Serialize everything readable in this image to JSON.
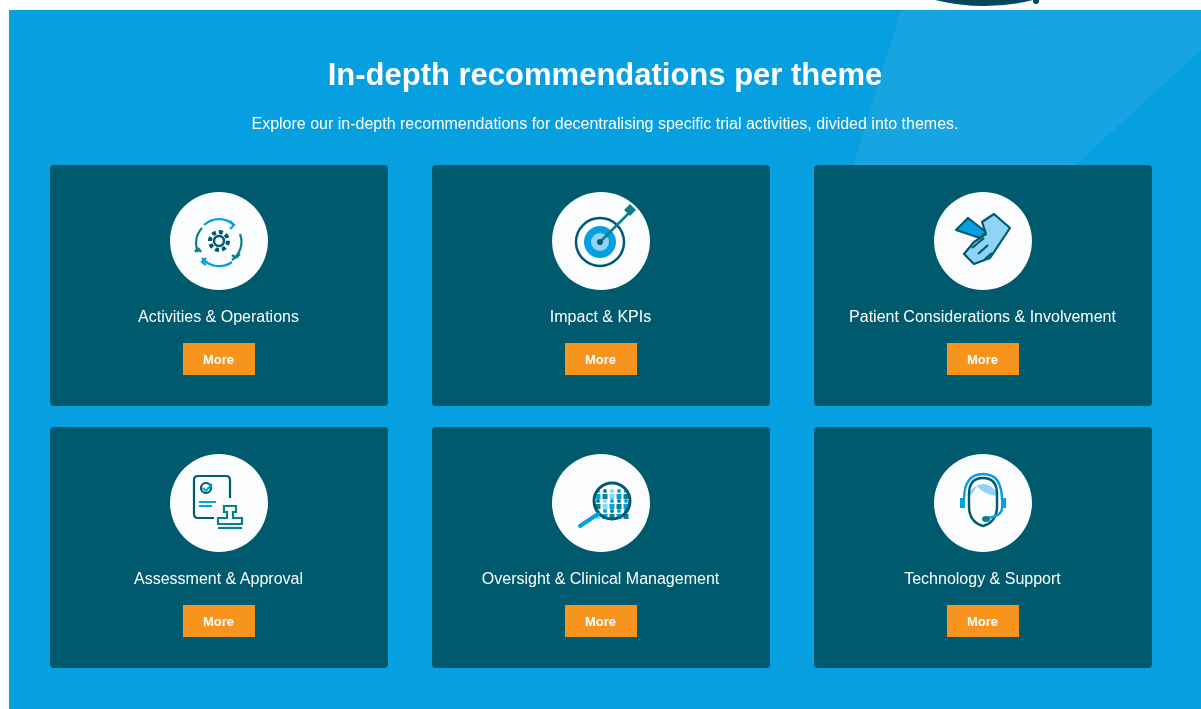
{
  "section": {
    "title": "In-depth recommendations per theme",
    "subtitle": "Explore our in-depth recommendations for decentralising specific trial activities, divided into themes."
  },
  "themes": [
    {
      "kind": "cycle",
      "label": "Activities & Operations",
      "button": "More"
    },
    {
      "kind": "target",
      "label": "Impact & KPIs",
      "button": "More"
    },
    {
      "kind": "handshake",
      "label": "Patient Considerations & Involvement",
      "button": "More"
    },
    {
      "kind": "stamp",
      "label": "Assessment & Approval",
      "button": "More"
    },
    {
      "kind": "magnifier",
      "label": "Oversight & Clinical Management",
      "button": "More"
    },
    {
      "kind": "headset",
      "label": "Technology & Support",
      "button": "More"
    }
  ]
}
